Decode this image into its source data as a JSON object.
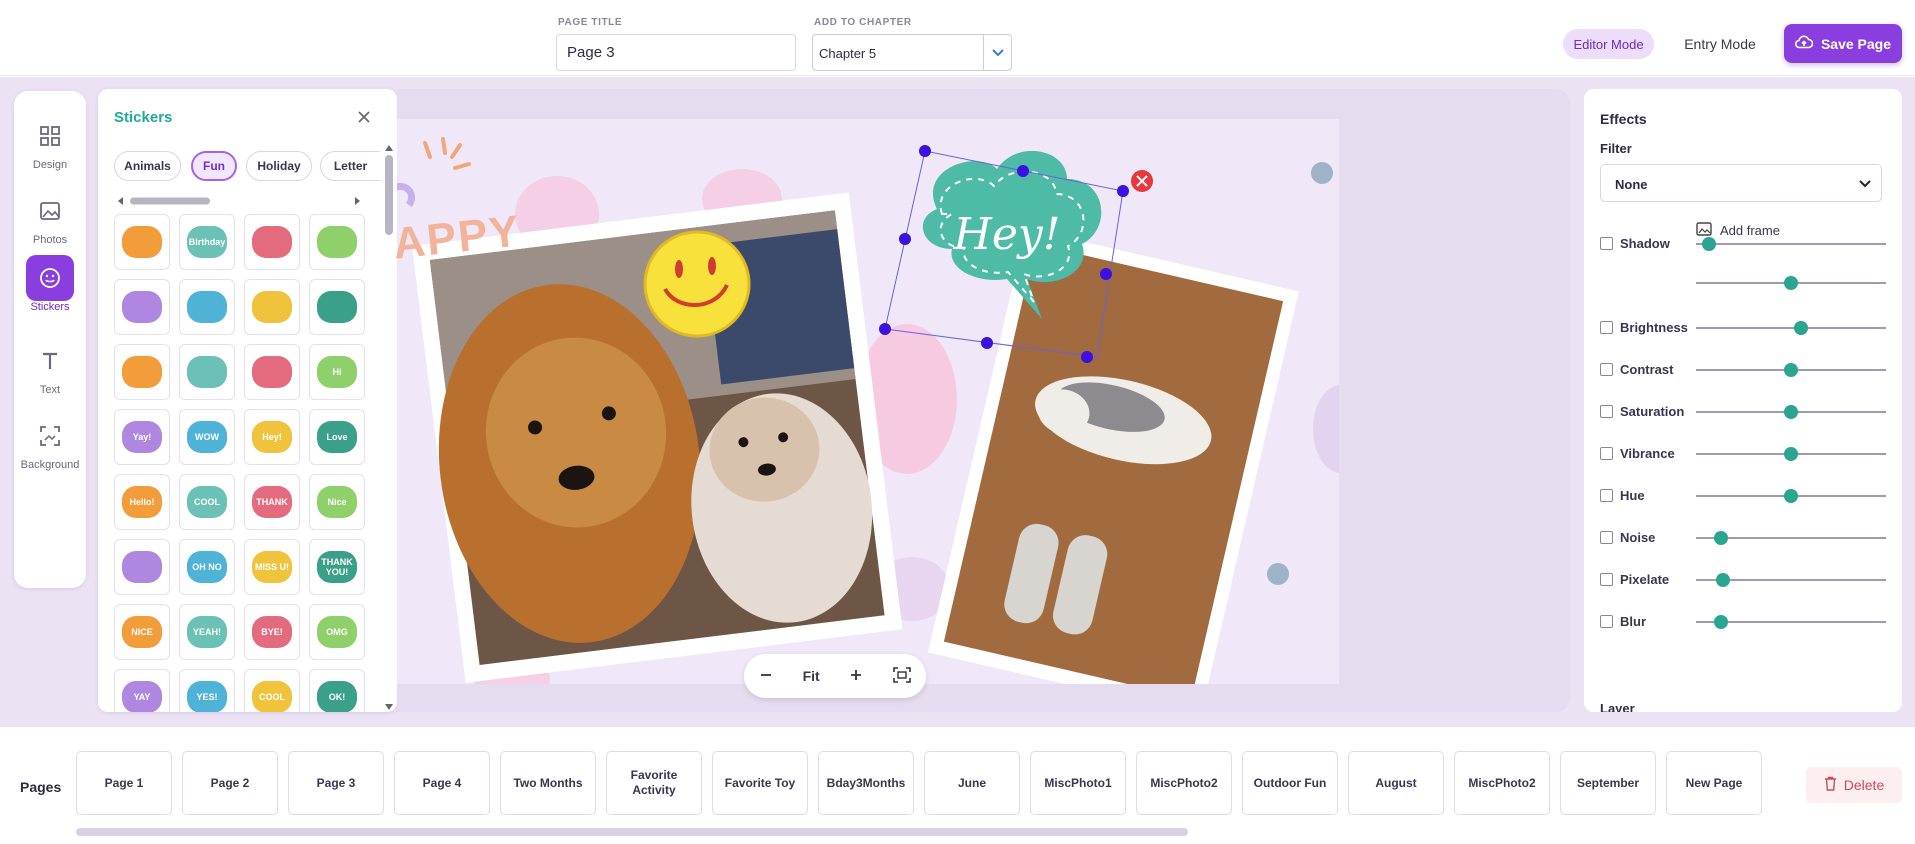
{
  "header": {
    "page_title_label": "PAGE TITLE",
    "page_title_value": "Page 3",
    "chapter_label": "ADD TO CHAPTER",
    "chapter_value": "Chapter 5",
    "editor_mode_label": "Editor Mode",
    "entry_mode_label": "Entry Mode",
    "save_label": "Save Page"
  },
  "rail": {
    "items": [
      {
        "label": "Design",
        "icon": "grid-icon"
      },
      {
        "label": "Photos",
        "icon": "image-icon"
      },
      {
        "label": "Stickers",
        "icon": "smiley-icon"
      },
      {
        "label": "Text",
        "icon": "text-icon"
      },
      {
        "label": "Background",
        "icon": "background-icon"
      }
    ],
    "active": "Stickers"
  },
  "stickers": {
    "title": "Stickers",
    "tabs": [
      "Animals",
      "Fun",
      "Holiday",
      "Letter"
    ],
    "active_tab": "Fun",
    "items": [
      {
        "name": "car-sticker",
        "text": ""
      },
      {
        "name": "birthday-sticker",
        "text": "Birthday"
      },
      {
        "name": "food-bowl-sticker",
        "text": ""
      },
      {
        "name": "cat-face-sticker",
        "text": ""
      },
      {
        "name": "starfish-sticker",
        "text": ""
      },
      {
        "name": "shell-sticker",
        "text": ""
      },
      {
        "name": "paw-prints-sticker",
        "text": ""
      },
      {
        "name": "bone-sticker",
        "text": ""
      },
      {
        "name": "paw-badge-sticker",
        "text": ""
      },
      {
        "name": "black-bone-sticker",
        "text": ""
      },
      {
        "name": "red-bowl-sticker",
        "text": ""
      },
      {
        "name": "speech-bubble-sticker",
        "text": "Hi"
      },
      {
        "name": "speech-bubble-sticker",
        "text": "Yay!"
      },
      {
        "name": "speech-bubble-sticker",
        "text": "WOW"
      },
      {
        "name": "speech-bubble-sticker",
        "text": "Hey!"
      },
      {
        "name": "speech-bubble-sticker",
        "text": "Love"
      },
      {
        "name": "speech-bubble-sticker",
        "text": "Hello!"
      },
      {
        "name": "speech-bubble-sticker",
        "text": "COOL"
      },
      {
        "name": "speech-bubble-sticker",
        "text": "THANK"
      },
      {
        "name": "speech-bubble-sticker",
        "text": "Nice"
      },
      {
        "name": "speech-bubble-sticker",
        "text": ""
      },
      {
        "name": "speech-bubble-sticker",
        "text": "OH NO"
      },
      {
        "name": "speech-bubble-sticker",
        "text": "MISS U!"
      },
      {
        "name": "speech-bubble-sticker",
        "text": "THANK YOU!"
      },
      {
        "name": "speech-bubble-sticker",
        "text": "NICE"
      },
      {
        "name": "speech-bubble-sticker",
        "text": "YEAH!"
      },
      {
        "name": "speech-bubble-sticker",
        "text": "BYE!"
      },
      {
        "name": "speech-bubble-sticker",
        "text": "OMG"
      },
      {
        "name": "speech-bubble-sticker",
        "text": "YAY"
      },
      {
        "name": "speech-bubble-sticker",
        "text": "YES!"
      },
      {
        "name": "speech-bubble-sticker",
        "text": "COOL"
      },
      {
        "name": "speech-bubble-sticker",
        "text": "OK!"
      }
    ]
  },
  "canvas": {
    "placed_text_fragments": [
      "APPY"
    ],
    "speech_sticker_text": "Hey!",
    "zoom_fit_label": "Fit"
  },
  "effects": {
    "title": "Effects",
    "filter_label": "Filter",
    "filter_value": "None",
    "add_frame_label": "Add frame",
    "rows": [
      {
        "label": "Shadow",
        "value": 0.07
      },
      {
        "label": "",
        "value": 0.5
      },
      {
        "label": "Brightness",
        "value": 0.55
      },
      {
        "label": "Contrast",
        "value": 0.5
      },
      {
        "label": "Saturation",
        "value": 0.5
      },
      {
        "label": "Vibrance",
        "value": 0.5
      },
      {
        "label": "Hue",
        "value": 0.5
      },
      {
        "label": "Noise",
        "value": 0.13
      },
      {
        "label": "Pixelate",
        "value": 0.14
      },
      {
        "label": "Blur",
        "value": 0.13
      }
    ],
    "layer_label": "Layer"
  },
  "pages": {
    "label": "Pages",
    "items": [
      "Page 1",
      "Page 2",
      "Page 3",
      "Page 4",
      "Two Months",
      "Favorite Activity",
      "Favorite Toy",
      "Bday3Months",
      "June",
      "MiscPhoto1",
      "MiscPhoto2",
      "Outdoor Fun",
      "August",
      "MiscPhoto2",
      "September",
      "New Page"
    ],
    "delete_label": "Delete"
  },
  "colors": {
    "accent": "#8a3ee0",
    "teal": "#21a8a0",
    "handle": "#3b10e0"
  }
}
